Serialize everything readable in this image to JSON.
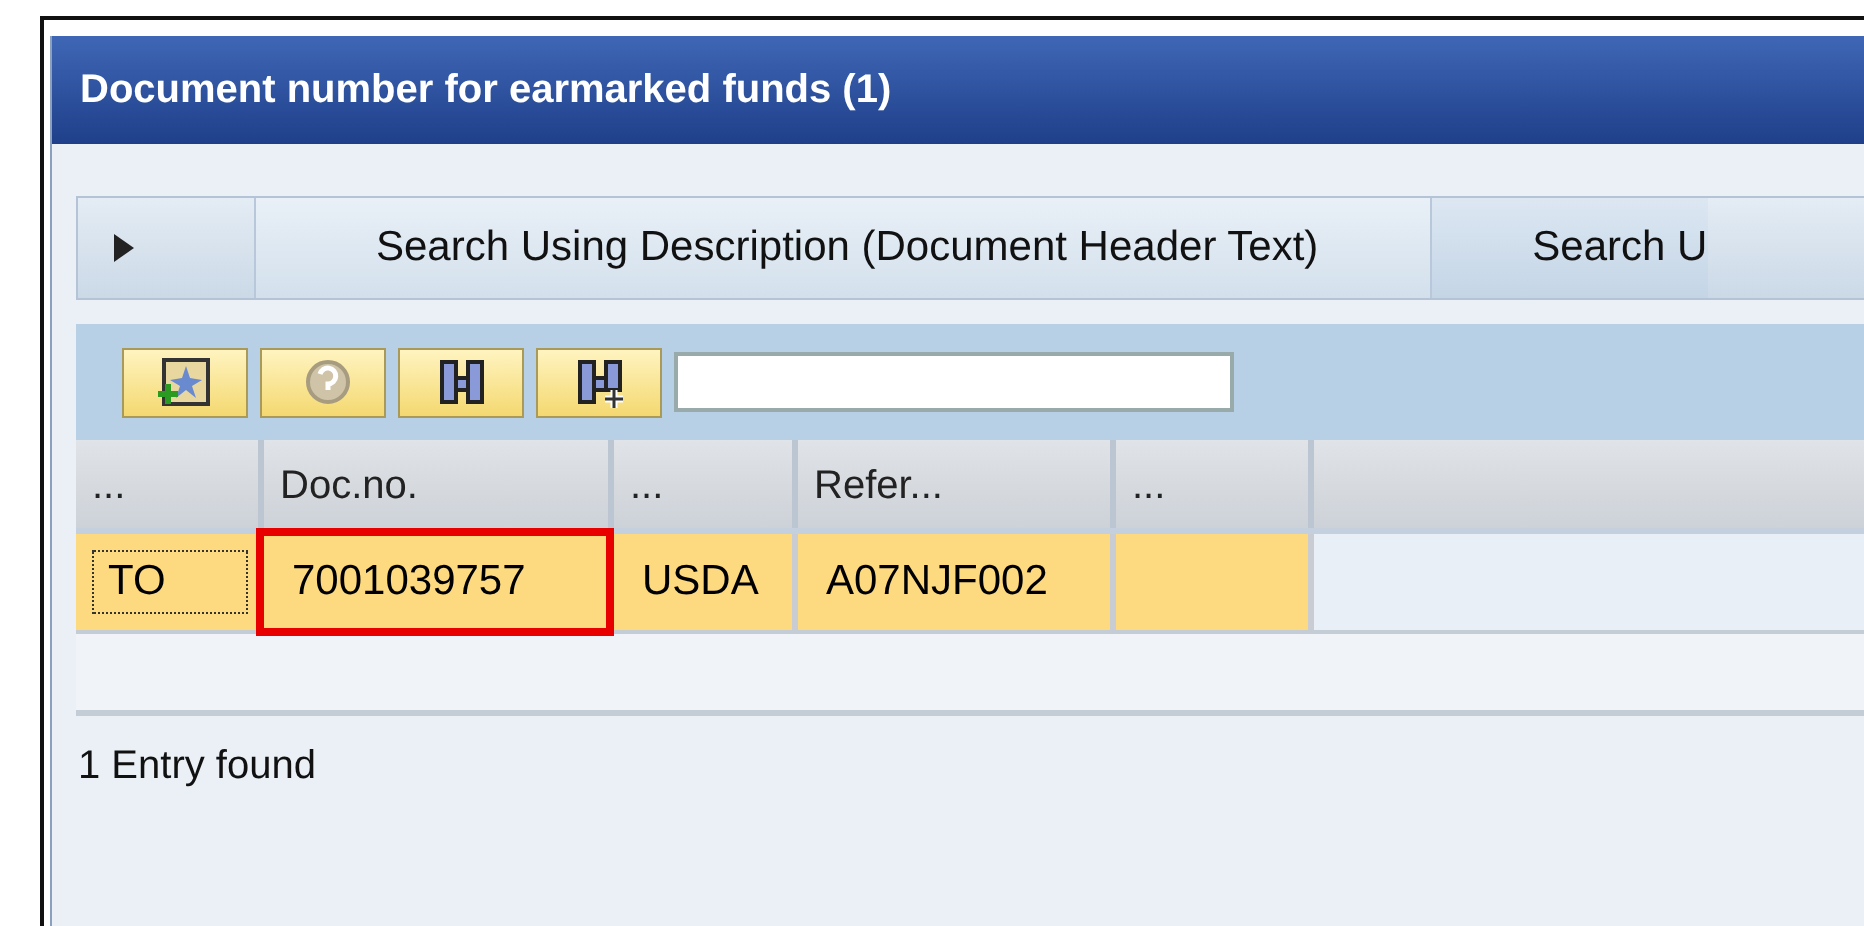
{
  "window": {
    "title": "Document number for earmarked funds (1)"
  },
  "tabs": [
    {
      "label": "Search Using Description (Document Header Text)",
      "selected": true
    },
    {
      "label": "Search U",
      "selected": false
    }
  ],
  "table": {
    "columns": [
      "...",
      "Doc.no.",
      "...",
      "Refer...",
      "..."
    ],
    "rows": [
      {
        "selected": true,
        "cells": [
          {
            "text": "TO",
            "focused": true,
            "highlighted": false
          },
          {
            "text": "7001039757",
            "focused": false,
            "highlighted": true
          },
          {
            "text": "USDA",
            "focused": false,
            "highlighted": false
          },
          {
            "text": "A07NJF002",
            "focused": false,
            "highlighted": false
          },
          {
            "focused": false,
            "highlighted": false
          }
        ]
      }
    ]
  },
  "status": "1 Entry found"
}
